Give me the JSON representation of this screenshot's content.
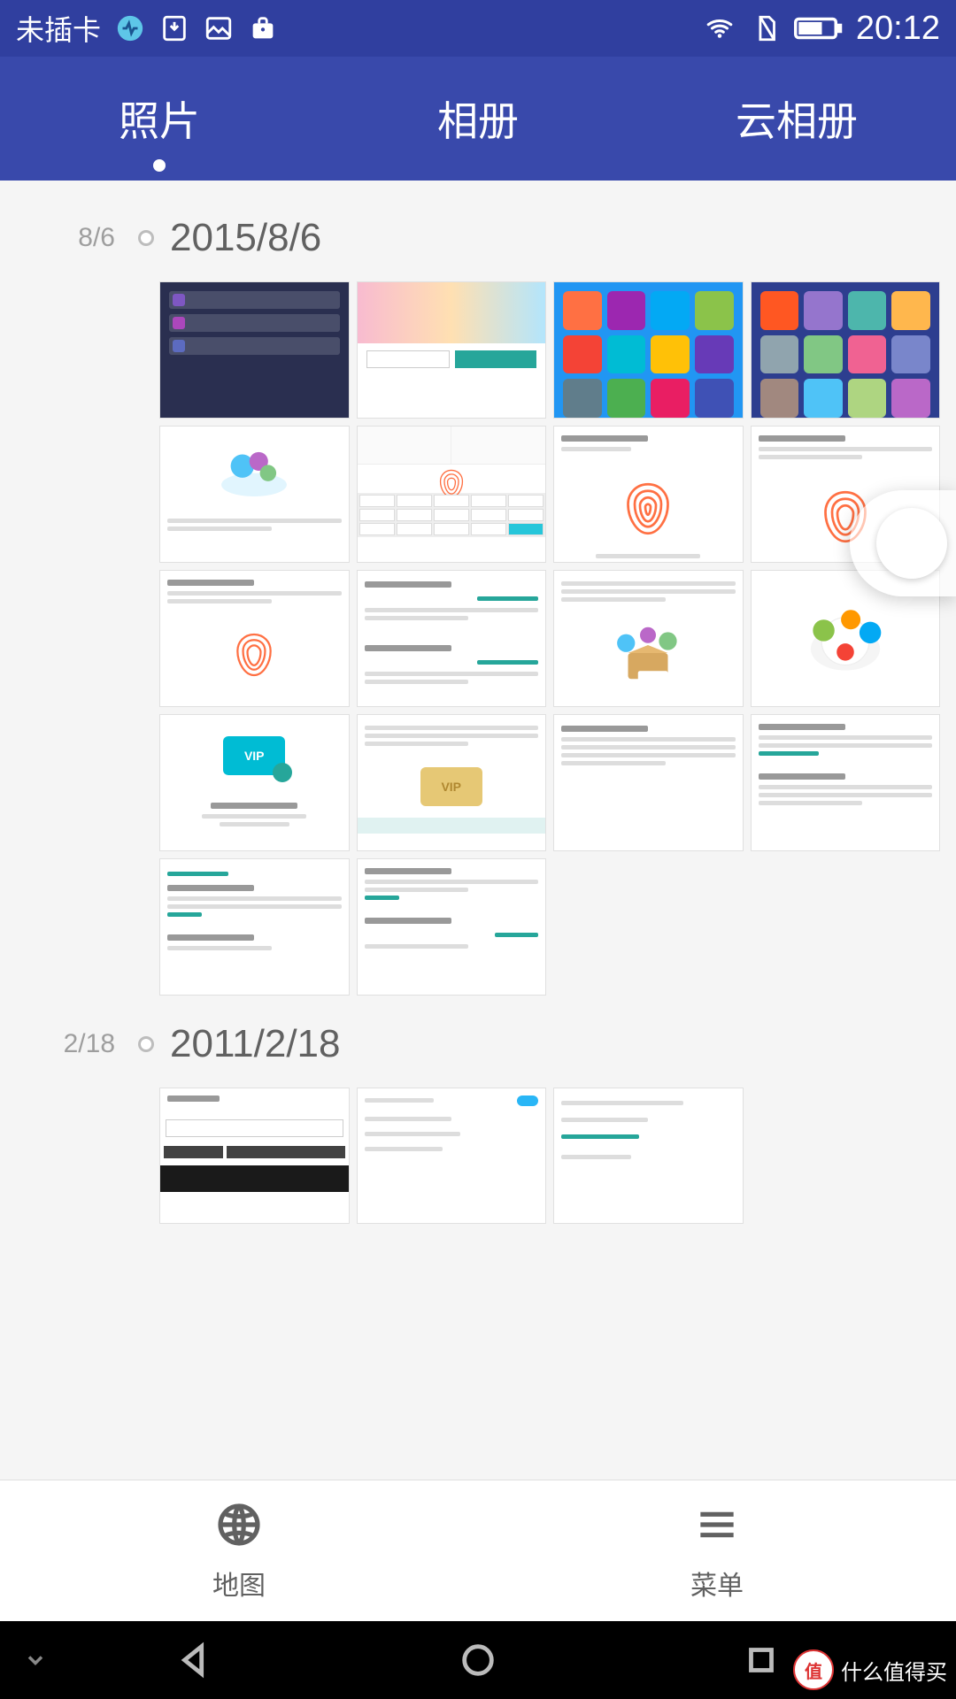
{
  "statusbar": {
    "sim_text": "未插卡",
    "time": "20:12"
  },
  "tabs": {
    "photos": "照片",
    "albums": "相册",
    "cloud": "云相册"
  },
  "sections": [
    {
      "short_date": "8/6",
      "full_date": "2015/8/6",
      "count": 18
    },
    {
      "short_date": "2/18",
      "full_date": "2011/2/18",
      "count": 3
    }
  ],
  "bottom": {
    "map": "地图",
    "menu": "菜单"
  },
  "watermark": {
    "badge": "值",
    "text": "什么值得买"
  },
  "thumb_labels": {
    "vip": "VIP"
  }
}
